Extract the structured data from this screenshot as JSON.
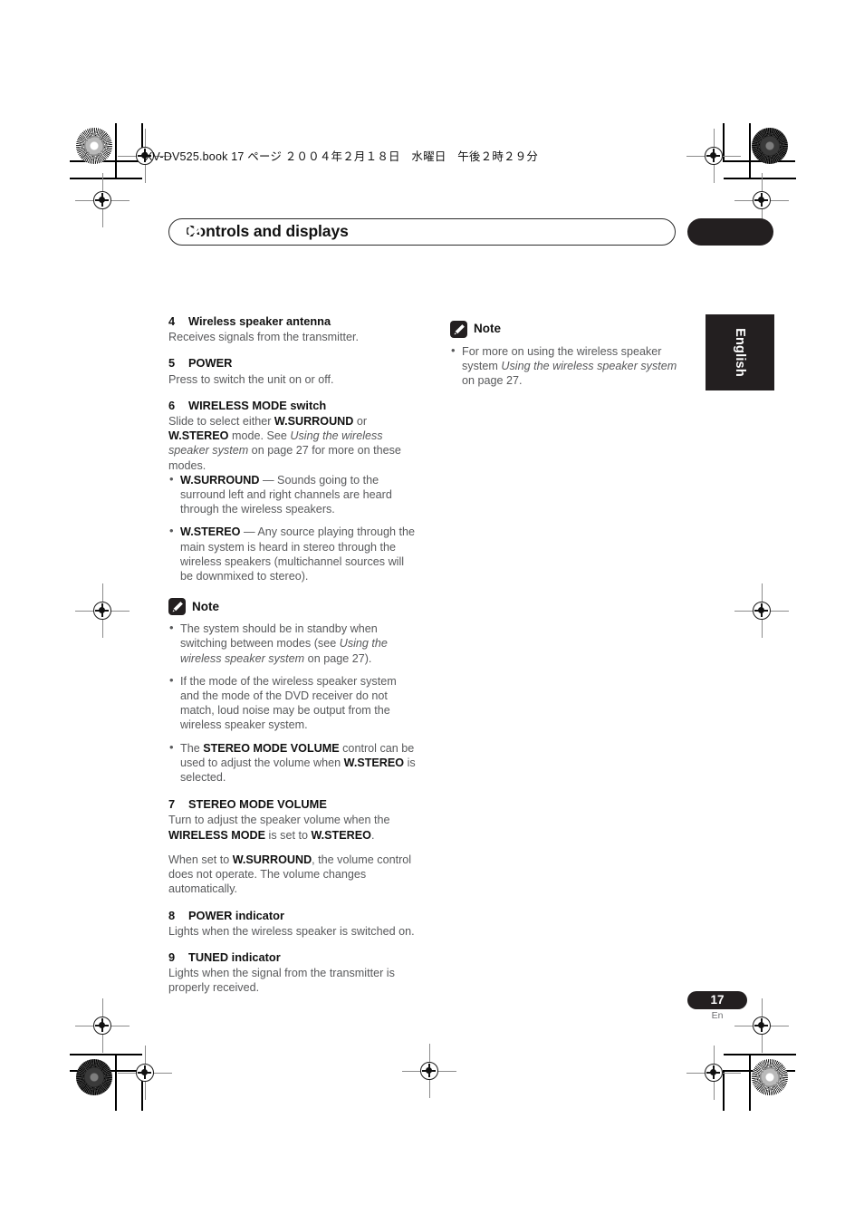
{
  "print_marks": {
    "file_info": "XV-DV525.book  17 ページ  ２００４年２月１８日　水曜日　午後２時２９分"
  },
  "header": {
    "title": "Controls and displays",
    "chapter": "02"
  },
  "language_tab": {
    "label": "English"
  },
  "left_column": {
    "entries": [
      {
        "number": "4",
        "title": "Wireless speaker antenna",
        "body": "Receives signals from the transmitter."
      },
      {
        "number": "5",
        "title": "POWER",
        "body": "Press to switch the unit on or off."
      },
      {
        "number": "6",
        "title": "WIRELESS MODE switch",
        "body_html": "Slide to select either <b>W.SURROUND</b> or <b>W.STEREO</b> mode. See <i>Using the wireless speaker system</i> on page 27 for more on these modes.",
        "bullets": [
          "<b>W.SURROUND</b> — Sounds going to the surround left and right channels are heard through the wireless speakers.",
          "<b>W.STEREO</b> — Any source playing through the main system is heard in stereo through the wireless speakers (multichannel sources will be downmixed to stereo)."
        ]
      }
    ],
    "note": {
      "label": "Note",
      "icon": "pencil-icon",
      "bullets": [
        "The system should be in standby when switching between modes (see <i>Using the wireless speaker system</i> on page 27).",
        "If the mode of the wireless speaker system and the mode of the DVD receiver do not match, loud noise may be output from the wireless speaker system.",
        "The <b>STEREO MODE VOLUME</b> control can be used to adjust the volume when <b>W.STEREO</b> is selected."
      ]
    },
    "entries_after_note": [
      {
        "number": "7",
        "title": "STEREO MODE VOLUME",
        "body_html": "Turn to adjust the speaker volume when the <b>WIRELESS MODE</b> is set to <b>W.STEREO</b>.",
        "body_html_2": "When set to <b>W.SURROUND</b>, the volume control does not operate. The volume changes automatically."
      },
      {
        "number": "8",
        "title": "POWER indicator",
        "body": "Lights when the wireless speaker is switched on."
      },
      {
        "number": "9",
        "title": "TUNED indicator",
        "body": "Lights when the signal from the transmitter is properly received."
      }
    ]
  },
  "right_column": {
    "note": {
      "label": "Note",
      "icon": "pencil-icon",
      "bullets": [
        "For more on using the wireless speaker system <i>Using the wireless speaker system</i> on page 27."
      ]
    }
  },
  "footer": {
    "page_number": "17",
    "page_language": "En"
  },
  "colors": {
    "ink_black": "#231f20",
    "body_gray": "#58595b",
    "paper": "#ffffff"
  }
}
